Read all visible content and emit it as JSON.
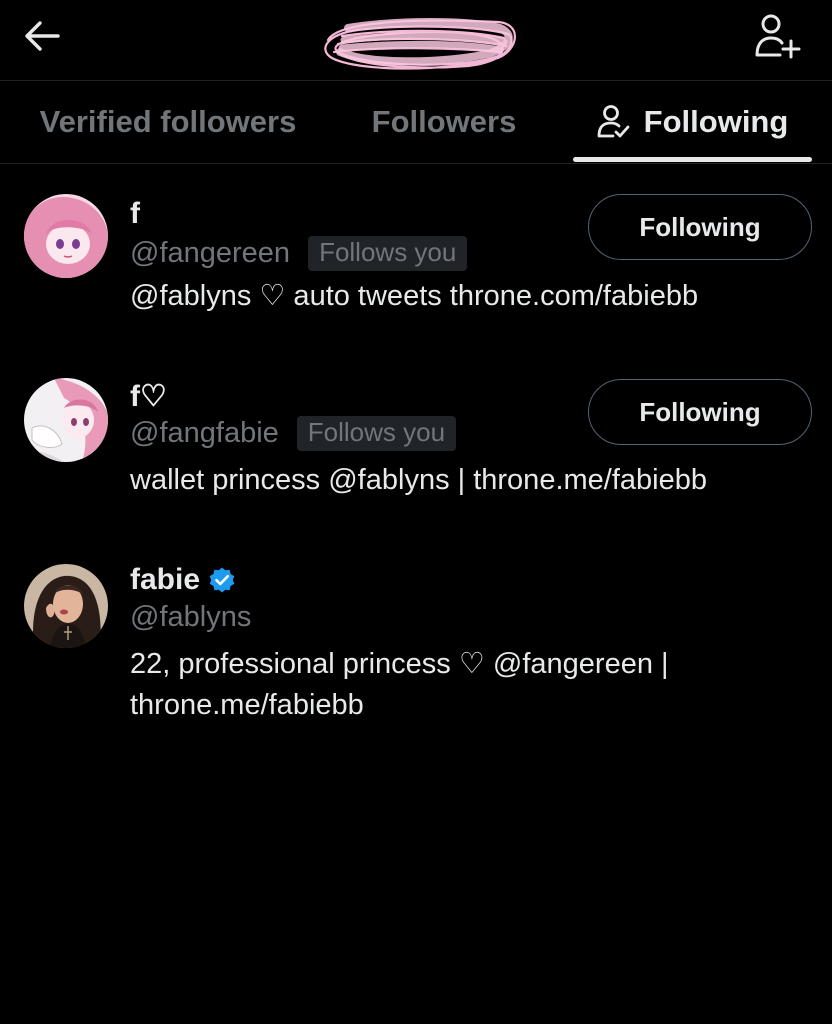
{
  "header": {
    "back_icon": "arrow-left-icon",
    "add_user_icon": "person-plus-icon"
  },
  "tabs": [
    {
      "label": "Verified followers",
      "active": false
    },
    {
      "label": "Followers",
      "active": false
    },
    {
      "label": "Following",
      "active": true,
      "icon": "person-check-icon"
    }
  ],
  "colors": {
    "background": "#000000",
    "primary_text": "#e7e9ea",
    "secondary_text": "#71767b",
    "verified": "#1d9bf0",
    "redaction_scribble": "#f4b8d6"
  },
  "users": [
    {
      "name": "f",
      "handle": "@fangereen",
      "follows_you": "Follows you",
      "bio": "@fablyns ♡ auto tweets throne.com/fabiebb",
      "button": "Following"
    },
    {
      "name": "f♡",
      "handle": "@fangfabie",
      "follows_you": "Follows you",
      "bio": "wallet princess @fablyns | throne.me/fabiebb",
      "button": "Following"
    },
    {
      "name": "fabie",
      "handle": "@fablyns",
      "verified": true,
      "bio_line1": "22, professional princess ♡ @fangereen |",
      "bio_line2": "throne.me/fabiebb"
    }
  ]
}
